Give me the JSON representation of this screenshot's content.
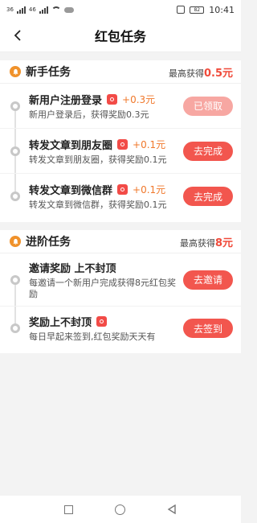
{
  "status_bar": {
    "left_labels": [
      "36",
      "46"
    ],
    "battery": "82",
    "time": "10:41"
  },
  "header": {
    "title": "红包任务",
    "back_icon": "back-arrow-icon"
  },
  "sections": [
    {
      "title": "新手任务",
      "max_prefix": "最高获得",
      "max_amount": "0.5元",
      "tasks": [
        {
          "title": "新用户注册登录",
          "reward": "+0.3元",
          "desc": "新用户登录后，获得奖励0.3元",
          "button": "已领取",
          "button_state": "disabled"
        },
        {
          "title": "转发文章到朋友圈",
          "reward": "+0.1元",
          "desc": "转发文章到朋友圈，获得奖励0.1元",
          "button": "去完成",
          "button_state": "active"
        },
        {
          "title": "转发文章到微信群",
          "reward": "+0.1元",
          "desc": "转发文章到微信群，获得奖励0.1元",
          "button": "去完成",
          "button_state": "active"
        }
      ]
    },
    {
      "title": "进阶任务",
      "max_prefix": "最高获得",
      "max_amount": "8元",
      "tasks": [
        {
          "title": "邀请奖励 上不封顶",
          "reward": "",
          "desc": "每邀请一个新用户完成获得8元红包奖励",
          "button": "去邀请",
          "button_state": "active"
        },
        {
          "title": "奖励上不封顶",
          "reward": "",
          "desc": "每日早起来签到,红包奖励天天有",
          "button": "去签到",
          "button_state": "active"
        }
      ]
    }
  ],
  "colors": {
    "accent": "#f2564e",
    "accent_disabled": "#f7a7a2",
    "reward": "#f0782b",
    "bell": "#f0922b"
  }
}
